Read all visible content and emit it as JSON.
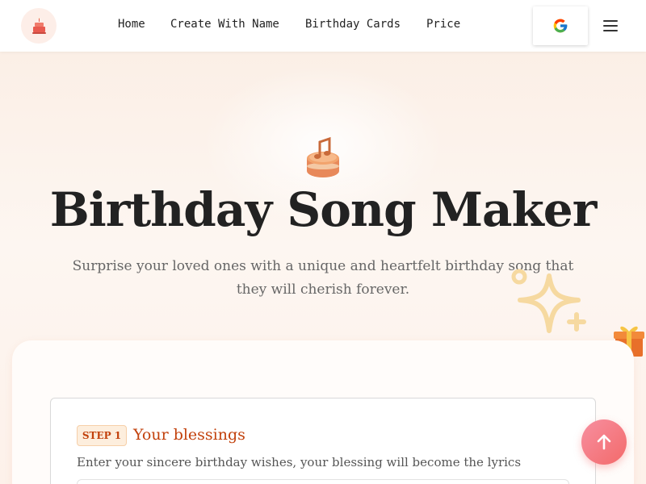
{
  "header": {
    "logo_icon": "birthday-cake-icon",
    "nav": [
      {
        "label": "Home"
      },
      {
        "label": "Create With Name"
      },
      {
        "label": "Birthday Cards"
      },
      {
        "label": "Price"
      }
    ],
    "google_icon": "google-icon",
    "menu_icon": "hamburger-menu-icon"
  },
  "hero": {
    "icon": "music-cake-icon",
    "title": "Birthday Song Maker",
    "subtitle": "Surprise your loved ones with a unique and heartfelt birthday song that they will cherish forever."
  },
  "decor": {
    "sparkle_icon": "sparkle-icon",
    "gift_icon": "gift-icon"
  },
  "step1": {
    "badge": "STEP 1",
    "title": "Your blessings",
    "description": "Enter your sincere birthday wishes, your blessing will become the lyrics"
  },
  "scroll_top_icon": "arrow-up-icon",
  "colors": {
    "accent": "#c2410c",
    "fab_gradient_start": "#f78fa0",
    "fab_gradient_end": "#f36a6a",
    "background": "#fdf3ec"
  }
}
